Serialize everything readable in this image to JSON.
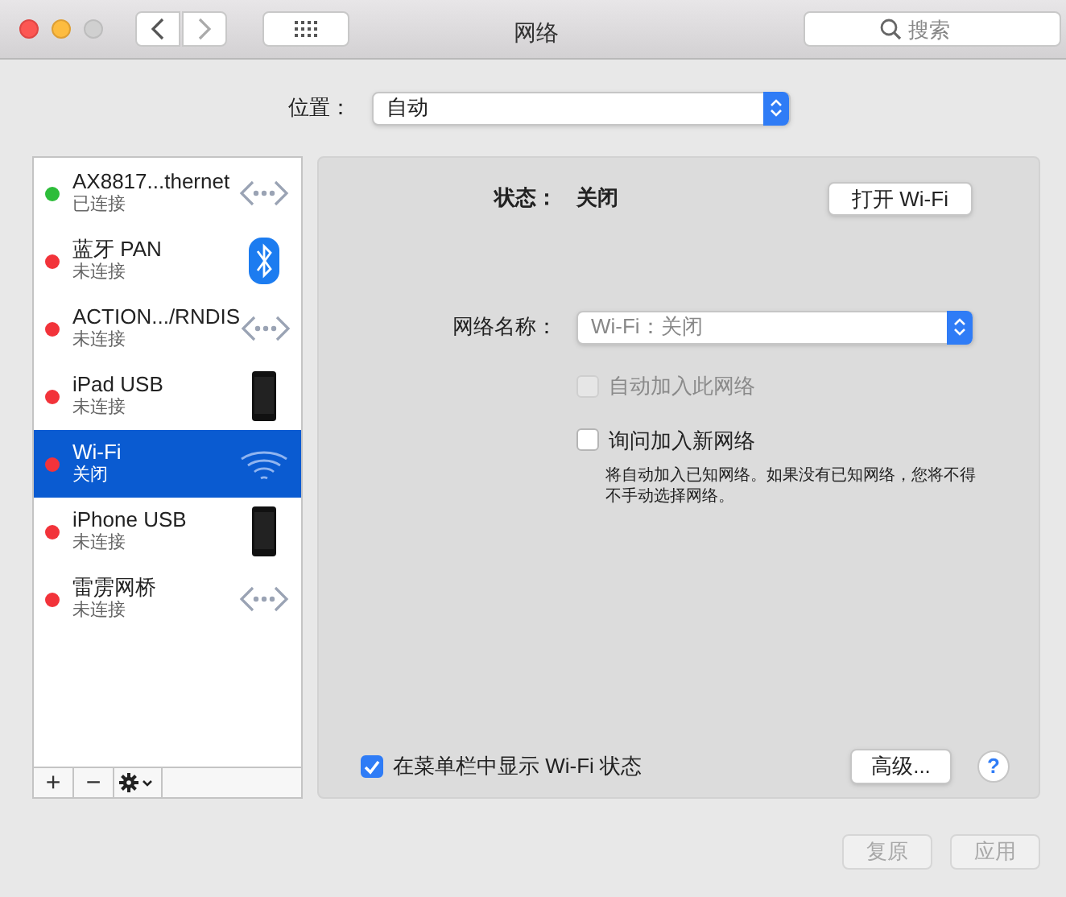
{
  "window": {
    "title": "网络"
  },
  "search": {
    "placeholder": "搜索"
  },
  "location": {
    "label": "位置：",
    "value": "自动"
  },
  "services": [
    {
      "name": "AX8817...thernet",
      "status": "已连接",
      "color": "#2dbd3a",
      "kind": "ethernet",
      "selected": false
    },
    {
      "name": "蓝牙 PAN",
      "status": "未连接",
      "color": "#f2333a",
      "kind": "bluetooth",
      "selected": false
    },
    {
      "name": "ACTION.../RNDIS",
      "status": "未连接",
      "color": "#f2333a",
      "kind": "ethernet",
      "selected": false
    },
    {
      "name": "iPad USB",
      "status": "未连接",
      "color": "#f2333a",
      "kind": "device",
      "selected": false
    },
    {
      "name": "Wi-Fi",
      "status": "关闭",
      "color": "#f2333a",
      "kind": "wifi",
      "selected": true
    },
    {
      "name": "iPhone USB",
      "status": "未连接",
      "color": "#f2333a",
      "kind": "device",
      "selected": false
    },
    {
      "name": "雷雳网桥",
      "status": "未连接",
      "color": "#f2333a",
      "kind": "ethernet",
      "selected": false
    }
  ],
  "list_buttons": [
    "+",
    "−"
  ],
  "detail": {
    "status_label": "状态：",
    "status_value": "关闭",
    "power_button": "打开 Wi-Fi",
    "network_label": "网络名称：",
    "network_value": "Wi-Fi：关闭",
    "options": [
      {
        "label": "自动加入此网络",
        "checked": false,
        "disabled": true
      },
      {
        "label": "询问加入新网络",
        "checked": false,
        "disabled": false
      }
    ],
    "note": "将自动加入已知网络。如果没有已知网络，您将不得不手动选择网络。",
    "menu_bar_option": {
      "label": "在菜单栏中显示 Wi-Fi 状态",
      "checked": true
    },
    "advanced_button": "高级...",
    "help_button": "?"
  },
  "footer_buttons": [
    {
      "label": "复原",
      "disabled": true
    },
    {
      "label": "应用",
      "disabled": true
    }
  ]
}
